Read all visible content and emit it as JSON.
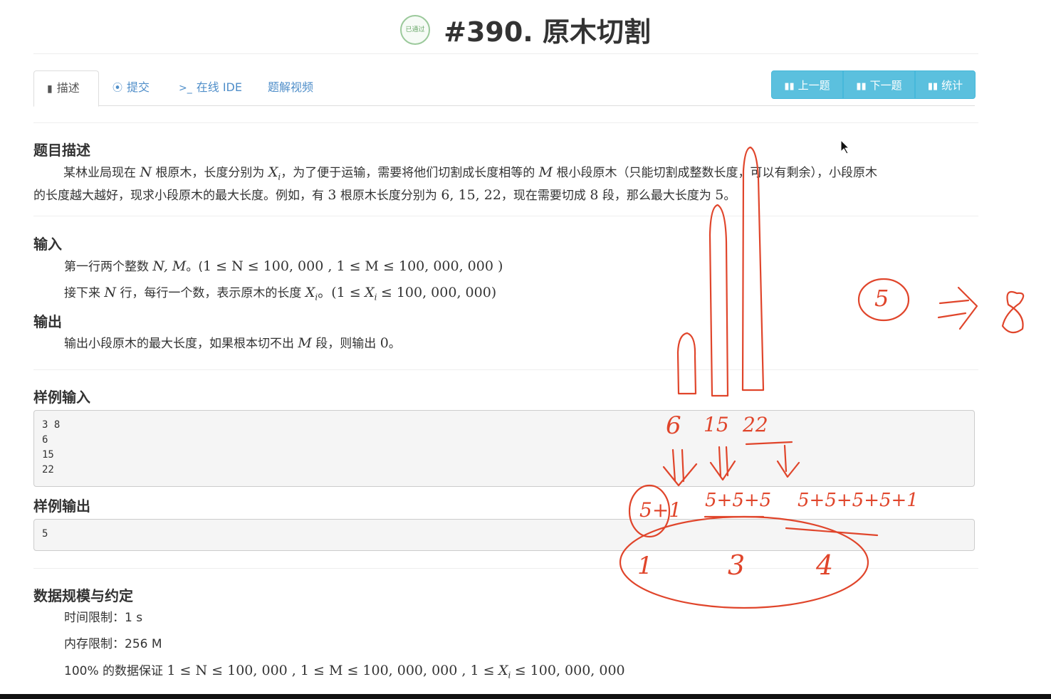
{
  "header": {
    "badge_text": "已通过",
    "title": "#390. 原木切割"
  },
  "tabs": [
    {
      "icon": "book-icon",
      "label": "描述"
    },
    {
      "icon": "upload-circle-icon",
      "label": "提交"
    },
    {
      "icon": "terminal-icon",
      "label": "在线 IDE"
    },
    {
      "icon": "",
      "label": "题解视频"
    }
  ],
  "nav_buttons": [
    {
      "icon": "bar-chart-icon",
      "label": "上一题"
    },
    {
      "icon": "bar-chart-icon",
      "label": "下一题"
    },
    {
      "icon": "bar-chart-icon",
      "label": "统计"
    }
  ],
  "description": {
    "heading": "题目描述",
    "p1": "某林业局现在",
    "p2": "根原木，长度分别为",
    "p3": "，为了便于运输，需要将他们切割成长度相等的",
    "p4": "根小段原木（只能切割成整数长度，可以有剩余），小段原木",
    "p5": "的长度越大越好，现求小段原木的最大长度。例如，有",
    "p6": "根原木长度分别为",
    "p7": "，现在需要切成",
    "p8": "段，那么最大长度为",
    "m_N": "N",
    "m_X": "X",
    "m_i": "i",
    "m_M": "M",
    "m_3": "3",
    "m_list": "6, 15, 22",
    "m_8": "8",
    "m_5": "5",
    "end": "。"
  },
  "input": {
    "heading": "输入",
    "l1a": "第一行两个整数",
    "l1m": "N, M",
    "l1b": "。(",
    "l1c": "1 ≤ N ≤ 100, 000 , 1 ≤ M ≤ 100, 000, 000 )",
    "l2a": "接下来",
    "l2b": "行，每行一个数，表示原木的长度",
    "l2c": "。(1 ≤",
    "l2d": "≤ 100, 000, 000)"
  },
  "output": {
    "heading": "输出",
    "l1a": "输出小段原木的最大长度，如果根本切不出",
    "l1b": "段，则输出",
    "l1c": "0",
    "l1d": "。"
  },
  "sample_input": {
    "heading": "样例输入",
    "content": "3 8\n6\n15\n22"
  },
  "sample_output": {
    "heading": "样例输出",
    "content": "5"
  },
  "constraints": {
    "heading": "数据规模与约定",
    "time_label": "时间限制：1 s",
    "mem_label": "内存限制：256 M",
    "guarantee_a": "100% 的数据保证",
    "guarantee_b": "1 ≤ N ≤ 100, 000 , 1 ≤ M ≤ 100, 000, 000 , 1 ≤",
    "guarantee_c": "≤ 100, 000, 000"
  },
  "annotations": {
    "ink_color": "#e0452b",
    "labels": [
      "6",
      "15",
      "22",
      "5+5+5",
      "5+5+5+5+1",
      "5+1",
      "1",
      "3",
      "4",
      "5",
      "=>",
      "8"
    ]
  }
}
